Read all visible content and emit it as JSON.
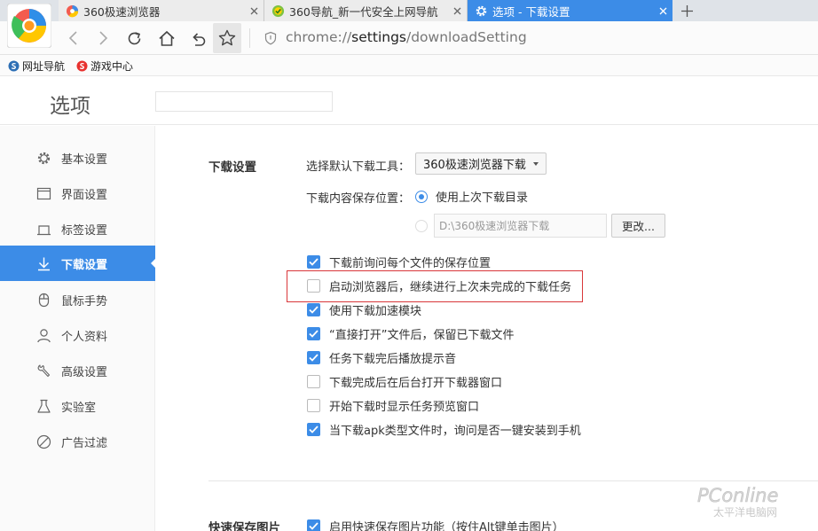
{
  "tabs": [
    {
      "title": "360极速浏览器",
      "icon": "chrome-360-icon",
      "active": false
    },
    {
      "title": "360导航_新一代安全上网导航",
      "icon": "360-nav-icon",
      "active": false
    },
    {
      "title": "选项 - 下载设置",
      "icon": "gear-icon",
      "active": true
    }
  ],
  "address": {
    "prefix": "chrome://",
    "strong": "settings",
    "suffix": "/downloadSetting"
  },
  "bookmarks": [
    {
      "label": "网址导航",
      "icon": "search-s-icon"
    },
    {
      "label": "游戏中心",
      "icon": "game-center-icon"
    }
  ],
  "header": {
    "title": "选项",
    "search_placeholder": ""
  },
  "sidebar": {
    "items": [
      {
        "label": "基本设置",
        "icon": "gear-icon"
      },
      {
        "label": "界面设置",
        "icon": "window-icon"
      },
      {
        "label": "标签设置",
        "icon": "tab-icon"
      },
      {
        "label": "下载设置",
        "icon": "download-icon",
        "active": true
      },
      {
        "label": "鼠标手势",
        "icon": "mouse-icon"
      },
      {
        "label": "个人资料",
        "icon": "user-icon"
      },
      {
        "label": "高级设置",
        "icon": "wrench-icon"
      },
      {
        "label": "实验室",
        "icon": "flask-icon"
      },
      {
        "label": "广告过滤",
        "icon": "block-icon"
      }
    ]
  },
  "download": {
    "section_title": "下载设置",
    "tool_label": "选择默认下载工具：",
    "tool_value": "360极速浏览器下载",
    "location_label": "下载内容保存位置：",
    "radio_last": "使用上次下载目录",
    "path_value": "D:\\360极速浏览器下载",
    "change_button": "更改...",
    "options": [
      {
        "label": "下载前询问每个文件的保存位置",
        "checked": true
      },
      {
        "label": "启动浏览器后，继续进行上次未完成的下载任务",
        "checked": false
      },
      {
        "label": "使用下载加速模块",
        "checked": true
      },
      {
        "label": "“直接打开”文件后，保留已下载文件",
        "checked": true
      },
      {
        "label": "任务下载完后播放提示音",
        "checked": true
      },
      {
        "label": "下载完成后在后台打开下载器窗口",
        "checked": false
      },
      {
        "label": "开始下载时显示任务预览窗口",
        "checked": false
      },
      {
        "label": "当下载apk类型文件时，询问是否一键安装到手机",
        "checked": true
      }
    ]
  },
  "image_save": {
    "section_title": "快速保存图片",
    "option": {
      "label": "启用快速保存图片功能（按住Alt键单击图片）",
      "checked": true
    }
  },
  "watermark": {
    "brand": "PConline",
    "tagline": "太平洋电脑网"
  },
  "colors": {
    "accent": "#3c8ce7",
    "highlight": "#d9373a"
  }
}
